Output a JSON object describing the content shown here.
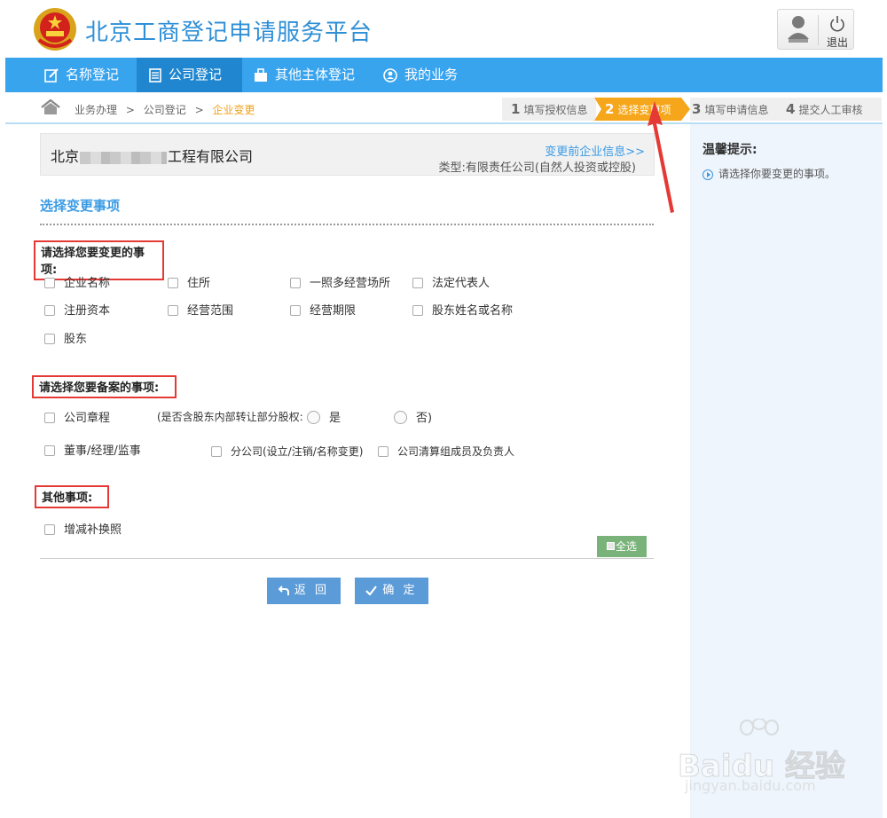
{
  "header": {
    "site_title": "北京工商登记申请服务平台",
    "logout_label": "退出"
  },
  "nav": {
    "items": [
      {
        "label": "名称登记",
        "icon": "edit-icon"
      },
      {
        "label": "公司登记",
        "icon": "document-icon"
      },
      {
        "label": "其他主体登记",
        "icon": "briefcase-icon"
      },
      {
        "label": "我的业务",
        "icon": "user-circle-icon"
      }
    ],
    "active_index": 1
  },
  "breadcrumb": {
    "items": [
      "业务办理",
      "公司登记",
      "企业变更"
    ],
    "separator": ">"
  },
  "steps": [
    {
      "num": "1",
      "label": "填写授权信息"
    },
    {
      "num": "2",
      "label": "选择变更项"
    },
    {
      "num": "3",
      "label": "填写申请信息"
    },
    {
      "num": "4",
      "label": "提交人工审核"
    }
  ],
  "company": {
    "name_prefix": "北京",
    "name_suffix": "工程有限公司",
    "link": "变更前企业信息>>",
    "type": "类型:有限责任公司(自然人投资或控股)"
  },
  "section_title": "选择变更事项",
  "change_group": {
    "label": "请选择您要变更的事项:",
    "options": [
      "企业名称",
      "住所",
      "一照多经营场所",
      "法定代表人",
      "注册资本",
      "经营范围",
      "经营期限",
      "股东姓名或名称",
      "股东"
    ]
  },
  "record_group": {
    "label": "请选择您要备案的事项:",
    "charter": "公司章程",
    "transfer_question": "(是否含股东内部转让部分股权:",
    "yes": "是",
    "no": "否)",
    "directors": "董事/经理/监事",
    "branch": "分公司(设立/注销/名称变更)",
    "liquidation": "公司清算组成员及负责人"
  },
  "other_group": {
    "label": "其他事项:",
    "option": "增减补换照"
  },
  "select_all": "全选",
  "buttons": {
    "back": "返 回",
    "confirm": "确 定"
  },
  "sidebar": {
    "title": "温馨提示:",
    "tip": "请选择你要变更的事项。"
  },
  "watermark": {
    "brand": "Baidu 经验",
    "url": "jingyan.baidu.com"
  },
  "colors": {
    "primary_blue": "#39a4ee",
    "active_nav": "#1f86cf",
    "step_active": "#f5a61b",
    "highlight_red": "#e53935",
    "select_all_green": "#79b37a",
    "button_blue": "#5b9bd8"
  }
}
